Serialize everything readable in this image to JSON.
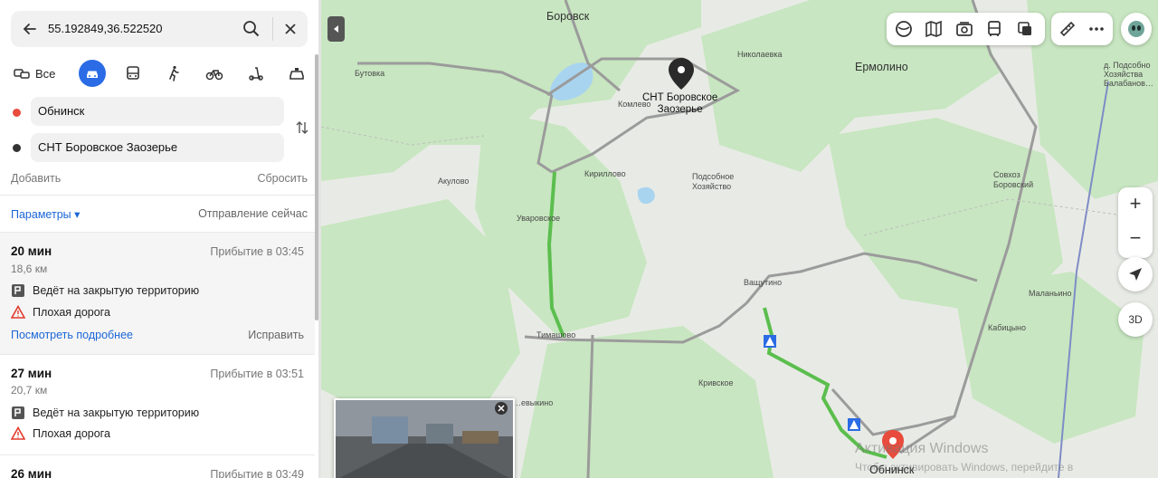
{
  "search": {
    "query": "55.192849,36.522520"
  },
  "modes": {
    "all_label": "Все"
  },
  "points": {
    "from": "Обнинск",
    "to": "СНТ Боровское Заозерье"
  },
  "actions": {
    "add": "Добавить",
    "reset": "Сбросить"
  },
  "params": {
    "label": "Параметры ▾",
    "departure": "Отправление сейчас"
  },
  "routes": [
    {
      "time": "20 мин",
      "arrival": "Прибытие в 03:45",
      "distance": "18,6 км",
      "closed": "Ведёт на закрытую территорию",
      "bad_road": "Плохая дорога",
      "more": "Посмотреть подробнее",
      "fix": "Исправить"
    },
    {
      "time": "27 мин",
      "arrival": "Прибытие в 03:51",
      "distance": "20,7 км",
      "closed": "Ведёт на закрытую территорию",
      "bad_road": "Плохая дорога"
    },
    {
      "time": "26 мин",
      "arrival": "Прибытие в 03:49"
    }
  ],
  "map": {
    "labels": {
      "borovsk": "Боровск",
      "nikolaevka": "Николаевка",
      "ermolino": "Ермолино",
      "butovka": "Бутовка",
      "komlevo": "Комлево",
      "dest1": "СНТ Боровское",
      "dest2": "Заозерье",
      "kirillovo": "Кириллово",
      "podsob1": "Подсобное",
      "podsob2": "Хозяйство",
      "akulovo": "Акулово",
      "uvarovskoe": "Уваровское",
      "sovhoz1": "Совхоз",
      "sovhoz2": "Боровский",
      "vashutino": "Ващутино",
      "malanino": "Маланьино",
      "timashovo": "Тимашово",
      "kabitsyno": "Кабицыно",
      "krivskoe": "Кривское",
      "obninsk": "Обнинск",
      "vykino": "…евыкино",
      "topright1": "д. Подсобно",
      "topright2": "Хозяйства",
      "topright3": "Балабанов…"
    },
    "btn_3d": "3D",
    "watermark1": "Активация Windows",
    "watermark2": "Чтобы активировать Windows, перейдите в"
  },
  "colors": {
    "accent": "#2b6be5",
    "route": "#5bbe4e",
    "origin": "#e84c3d",
    "link": "#1b66d6"
  }
}
